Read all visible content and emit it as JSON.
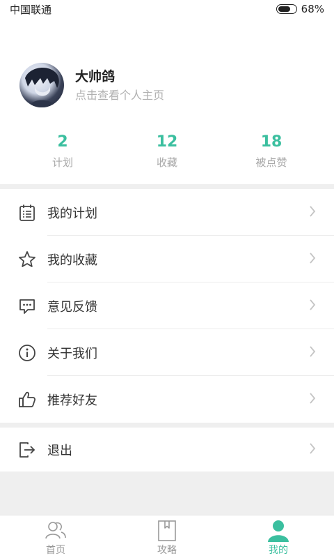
{
  "status_bar": {
    "carrier": "中国联通",
    "battery": "68%"
  },
  "profile": {
    "name": "大帅鸽",
    "subtitle": "点击查看个人主页"
  },
  "stats": [
    {
      "value": "2",
      "label": "计划"
    },
    {
      "value": "12",
      "label": "收藏"
    },
    {
      "value": "18",
      "label": "被点赞"
    }
  ],
  "menu": [
    {
      "label": "我的计划",
      "icon": "calendar-list-icon"
    },
    {
      "label": "我的收藏",
      "icon": "star-icon"
    },
    {
      "label": "意见反馈",
      "icon": "chat-bubble-icon"
    },
    {
      "label": "关于我们",
      "icon": "info-icon"
    },
    {
      "label": "推荐好友",
      "icon": "thumbs-up-icon"
    }
  ],
  "logout": {
    "label": "退出",
    "icon": "logout-icon"
  },
  "tabs": [
    {
      "label": "首页",
      "icon": "people-icon",
      "active": false
    },
    {
      "label": "攻略",
      "icon": "bookmark-book-icon",
      "active": false
    },
    {
      "label": "我的",
      "icon": "person-icon",
      "active": true
    }
  ],
  "colors": {
    "accent": "#3bbf9f",
    "muted": "#a8a8a8",
    "divider": "#efefef"
  }
}
